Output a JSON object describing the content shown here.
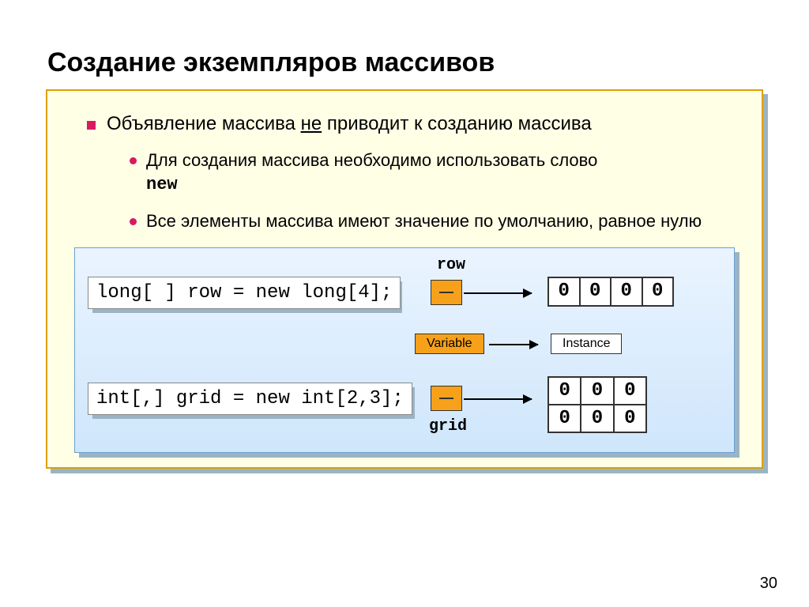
{
  "title": "Создание экземпляров массивов",
  "bullet_top": {
    "pre": "Объявление массива ",
    "underlined": "не",
    "post": " приводит к созданию массива"
  },
  "sub1": {
    "text": "Для создания массива необходимо использовать слово ",
    "code": "new"
  },
  "sub2": "Все элементы массива имеют значение по умолчанию, равное нулю",
  "code1": "long[ ] row = new long[4];",
  "code2": "int[,] grid = new int[2,3];",
  "labels": {
    "row": "row",
    "grid": "grid"
  },
  "legend": {
    "variable": "Variable",
    "instance": "Instance"
  },
  "row_values": [
    "0",
    "0",
    "0",
    "0"
  ],
  "grid_values": [
    "0",
    "0",
    "0",
    "0",
    "0",
    "0"
  ],
  "page": "30"
}
